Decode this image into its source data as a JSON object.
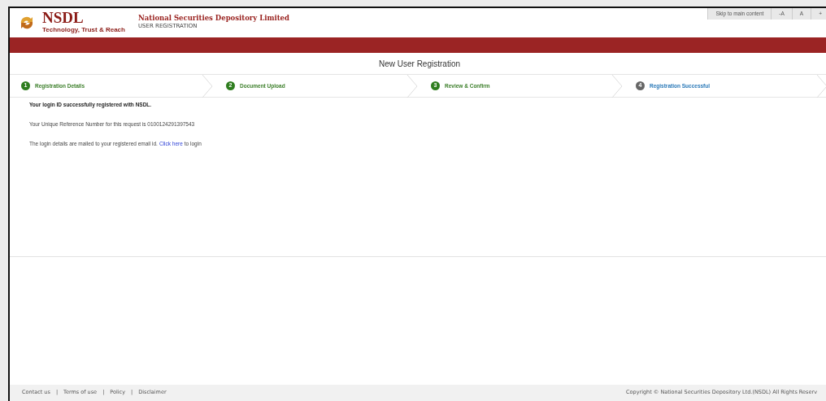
{
  "header": {
    "logo_text": "NSDL",
    "tagline": "Technology, Trust & Reach",
    "org_name": "National Securities Depository Limited",
    "subtitle": "USER REGISTRATION"
  },
  "accessibility": [
    "Skip to main content",
    "-A",
    "A",
    "+"
  ],
  "page_title": "New User Registration",
  "steps": [
    {
      "number": "1",
      "label": "Registration Details",
      "completed": true
    },
    {
      "number": "2",
      "label": "Document Upload",
      "completed": true
    },
    {
      "number": "3",
      "label": "Review & Confirm",
      "completed": true
    },
    {
      "number": "4",
      "label": "Registration Successful",
      "completed": false
    }
  ],
  "messages": {
    "success": "Your login ID successfully registered with NSDL.",
    "reference": "Your Unique Reference Number for this request is 0100124291397543",
    "mail_before": "The login details are mailed to your registered email id.",
    "link": "Click here",
    "mail_after": "to login"
  },
  "footer": {
    "items": [
      {
        "kind": "link",
        "text": "Contact us"
      },
      {
        "kind": "separator",
        "text": "|"
      },
      {
        "kind": "link",
        "text": "Terms of use"
      },
      {
        "kind": "separator",
        "text": "|"
      },
      {
        "kind": "link",
        "text": "Policy"
      },
      {
        "kind": "separator",
        "text": "|"
      },
      {
        "kind": "link",
        "text": "Disclaimer"
      }
    ],
    "copyright": "Copyright © National Securities Depository Ltd.(NSDL) All Rights Reserv"
  }
}
